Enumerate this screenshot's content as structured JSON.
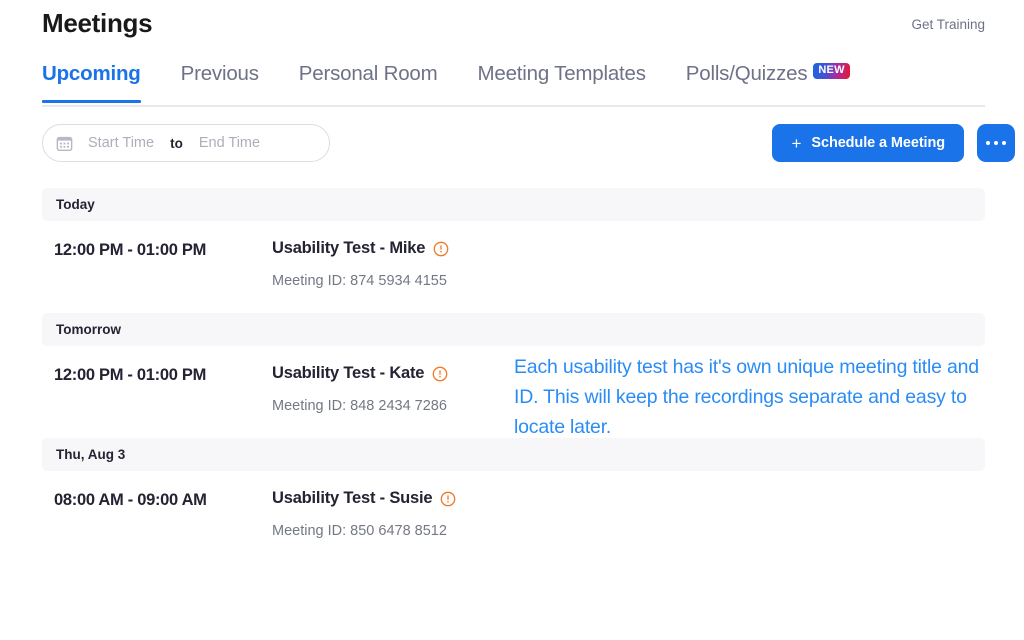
{
  "header": {
    "title": "Meetings",
    "get_training": "Get Training"
  },
  "tabs": [
    {
      "label": "Upcoming",
      "active": true,
      "badge": null
    },
    {
      "label": "Previous",
      "active": false,
      "badge": null
    },
    {
      "label": "Personal Room",
      "active": false,
      "badge": null
    },
    {
      "label": "Meeting Templates",
      "active": false,
      "badge": null
    },
    {
      "label": "Polls/Quizzes",
      "active": false,
      "badge": "NEW"
    }
  ],
  "toolbar": {
    "date_range": {
      "icon": "calendar-icon",
      "start_placeholder": "Start Time",
      "separator": "to",
      "end_placeholder": "End Time",
      "start_value": "",
      "end_value": ""
    },
    "schedule_button": {
      "plus": "+",
      "label": "Schedule a Meeting"
    },
    "more_button": "more-options"
  },
  "groups": [
    {
      "label": "Today",
      "meetings": [
        {
          "time": "12:00 PM - 01:00 PM",
          "title": "Usability Test - Mike",
          "warning_icon": "warning-circle-icon",
          "meeting_id": "Meeting ID: 874 5934 4155"
        }
      ]
    },
    {
      "label": "Tomorrow",
      "meetings": [
        {
          "time": "12:00 PM - 01:00 PM",
          "title": "Usability Test - Kate",
          "warning_icon": "warning-circle-icon",
          "meeting_id": "Meeting ID: 848 2434 7286"
        }
      ]
    },
    {
      "label": "Thu, Aug 3",
      "meetings": [
        {
          "time": "08:00 AM - 09:00 AM",
          "title": "Usability Test - Susie",
          "warning_icon": "warning-circle-icon",
          "meeting_id": "Meeting ID: 850 6478 8512"
        }
      ]
    }
  ],
  "annotation": {
    "text": "Each usability test has it's own unique meeting title and ID. This will keep the recordings separate and easy to locate later."
  },
  "colors": {
    "accent_blue": "#1a73e8",
    "annotation_blue": "#2a8cf5",
    "warning_orange": "#f07a26",
    "text_dark": "#232333",
    "text_muted": "#6e7287",
    "band_gray": "#f7f7f9"
  }
}
